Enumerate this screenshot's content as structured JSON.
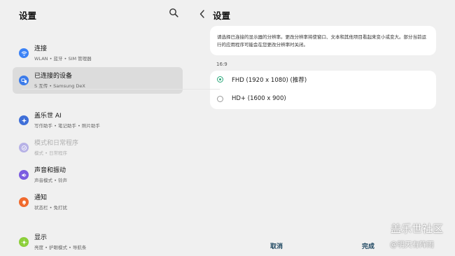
{
  "left": {
    "title": "设置",
    "items": [
      {
        "label": "连接",
        "sub": "WLAN • 蓝牙 • SIM 管理器",
        "color": "#3b82f6",
        "icon": "wifi-icon"
      },
      {
        "label": "已连接的设备",
        "sub": "S 互传 • Samsung DeX",
        "color": "#3b7bea",
        "icon": "devices-icon"
      },
      {
        "label": "盖乐世 AI",
        "sub": "写作助手 • 笔记助手 • 照片助手",
        "color": "#3f6fd8",
        "icon": "ai-sparkle-icon"
      },
      {
        "label": "模式和日常程序",
        "sub": "模式 • 日常程序",
        "color": "#b7b2e6",
        "icon": "modes-check-icon"
      },
      {
        "label": "声音和振动",
        "sub": "声音模式 • 铃声",
        "color": "#7b5ce0",
        "icon": "sound-icon"
      },
      {
        "label": "通知",
        "sub": "状态栏 • 免打扰",
        "color": "#f06a2d",
        "icon": "bell-icon"
      },
      {
        "label": "显示",
        "sub": "亮度 • 护眼模式 • 导航条",
        "color": "#8ccf3a",
        "icon": "sun-icon"
      }
    ]
  },
  "right": {
    "title": "设置",
    "description": "请选择已连接的显示器的分辨率。更改分辨率将使窗口、文本和其他项目看起来变小或变大。部分当前运行的应用程序可能会在您更改分辨率时关闭。",
    "section_label": "16:9",
    "options": [
      {
        "label": "FHD (1920 x 1080) (推荐)",
        "selected": true
      },
      {
        "label": "HD+ (1600 x 900)",
        "selected": false
      }
    ],
    "cancel_label": "取消",
    "done_label": "完成"
  },
  "watermark": {
    "line1": "盖乐世社区",
    "line2": "@明天有阵雨"
  },
  "colors": {
    "accent": "#2aa87a",
    "button_text": "#1d4660"
  }
}
